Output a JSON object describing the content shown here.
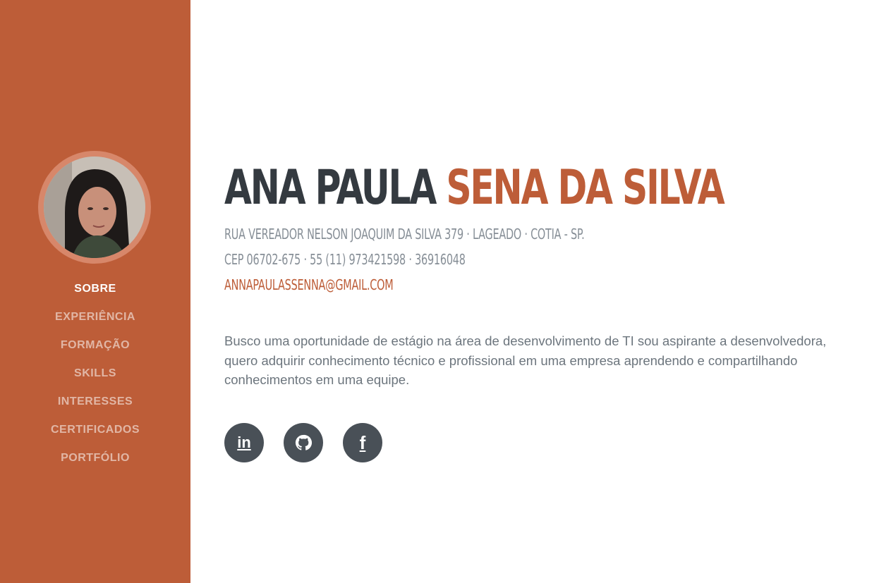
{
  "profile": {
    "photo_icon": "profile-photo"
  },
  "nav": {
    "items": [
      {
        "label": "SOBRE",
        "active": true
      },
      {
        "label": "EXPERIÊNCIA",
        "active": false
      },
      {
        "label": "FORMAÇÃO",
        "active": false
      },
      {
        "label": "SKILLS",
        "active": false
      },
      {
        "label": "INTERESSES",
        "active": false
      },
      {
        "label": "CERTIFICADOS",
        "active": false
      },
      {
        "label": "PORTFÓLIO",
        "active": false
      }
    ]
  },
  "header": {
    "first_name": "ANA PAULA",
    "last_name": "SENA DA SILVA",
    "address_line": "RUA VEREADOR NELSON JOAQUIM DA SILVA 379 · LAGEADO · COTIA - SP.",
    "contact_line": "CEP 06702-675 · 55 (11) 973421598 · 36916048",
    "email": "ANNAPAULASSENNA@GMAIL.COM"
  },
  "about": {
    "text": "Busco uma oportunidade de estágio na área de desenvolvimento de TI sou aspirante a desenvolvedora, quero adquirir conhecimento técnico e profissional em uma empresa aprendendo e compartilhando conhecimentos em uma equipe."
  },
  "social": {
    "linkedin_glyph": "in",
    "linkedin_icon": "linkedin-icon",
    "github_icon": "github-icon",
    "facebook_glyph": "f",
    "facebook_icon": "facebook-icon"
  },
  "colors": {
    "sidebar": "#bd5d38",
    "accent": "#bd5d38",
    "heading": "#343a40",
    "muted": "#868e96",
    "social_bg": "#495057"
  }
}
